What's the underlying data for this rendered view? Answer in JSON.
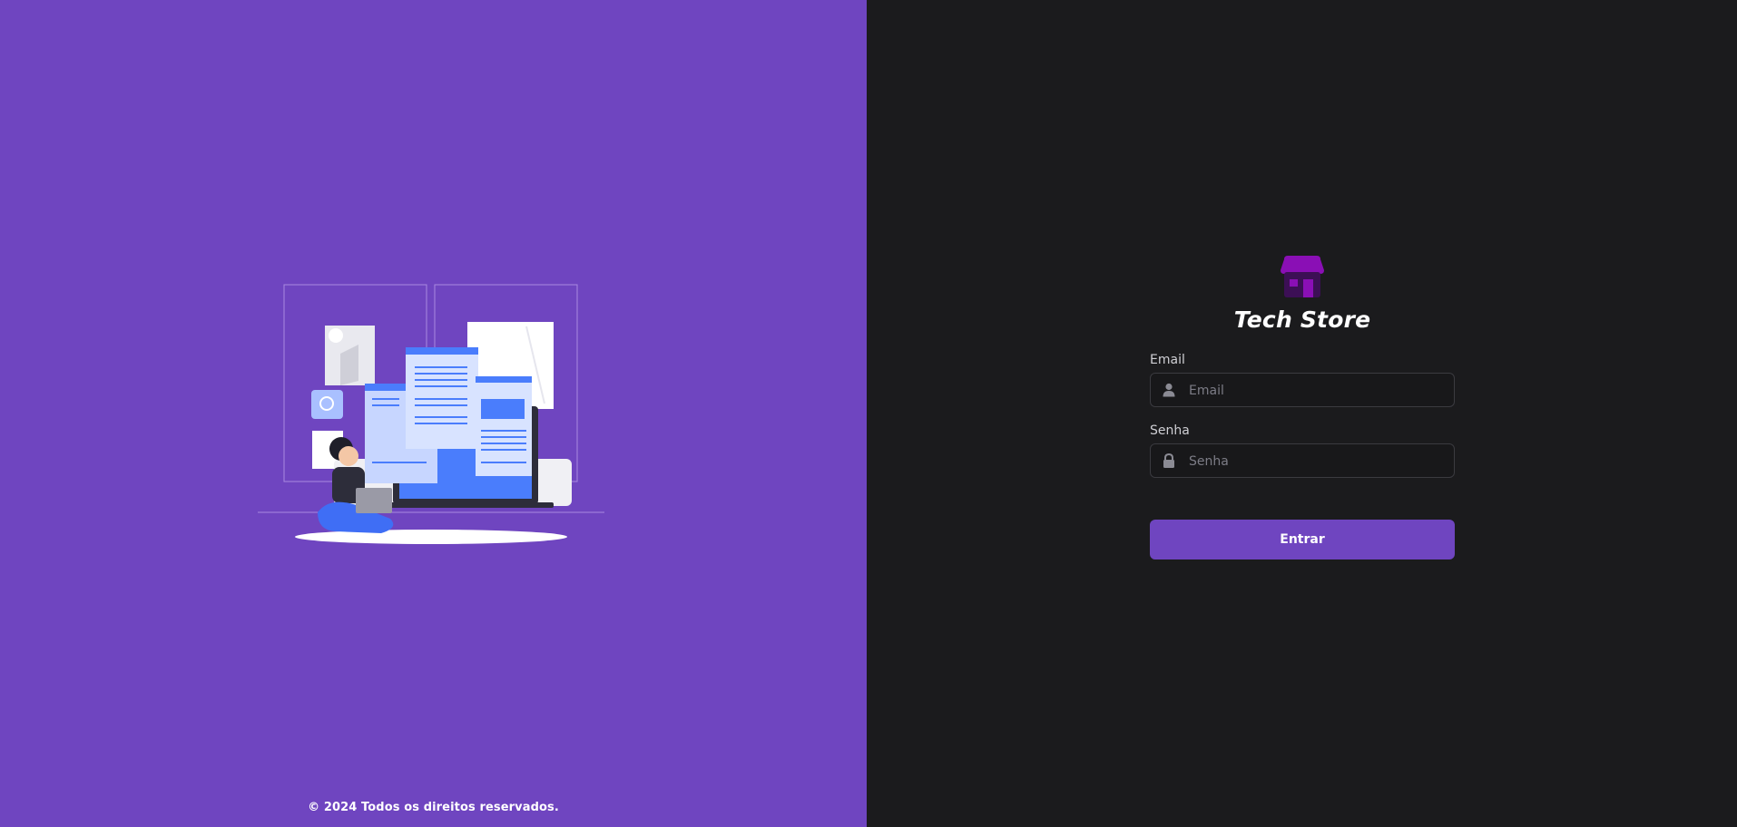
{
  "brand": {
    "name": "Tech Store",
    "icon": "store-icon",
    "icon_color": "#8a0fb5"
  },
  "form": {
    "email_label": "Email",
    "email_placeholder": "Email",
    "email_icon": "user-icon",
    "password_label": "Senha",
    "password_placeholder": "Senha",
    "password_icon": "lock-icon",
    "submit_label": "Entrar"
  },
  "footer": {
    "copyright": "© 2024 Todos os direitos reservados."
  },
  "colors": {
    "accent": "#6f45c0",
    "right_background": "#1b1b1d",
    "input_border": "#3b3b40"
  }
}
